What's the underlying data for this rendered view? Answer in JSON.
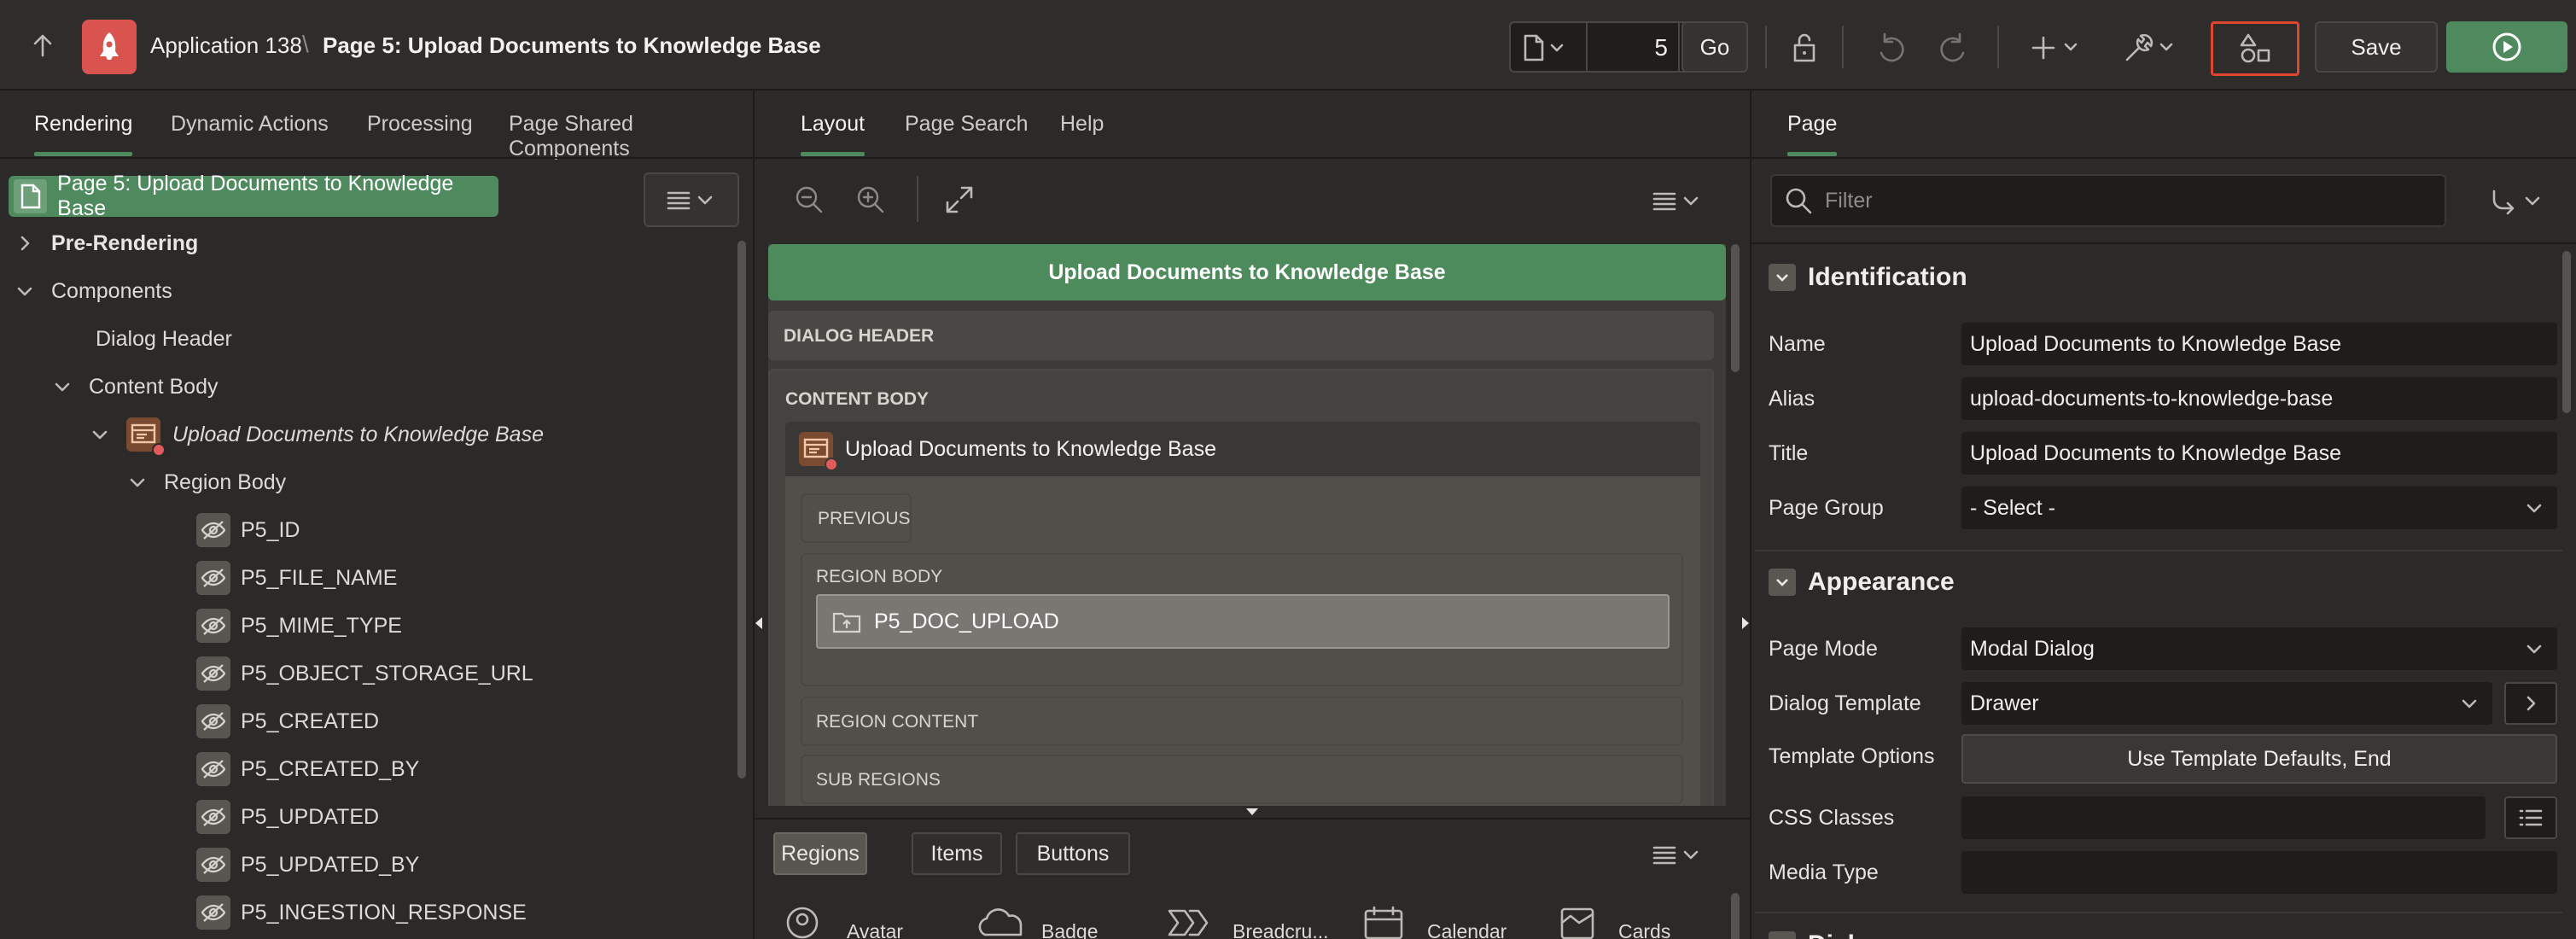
{
  "topbar": {
    "app_name": "Application 138",
    "separator": "\\",
    "page_title": "Page 5: Upload Documents to Knowledge Base",
    "page_number": "5",
    "go_label": "Go",
    "save_label": "Save"
  },
  "left": {
    "tabs": [
      "Rendering",
      "Dynamic Actions",
      "Processing",
      "Page Shared Components"
    ],
    "page_node": "Page 5: Upload Documents to Knowledge Base",
    "tree": {
      "pre_rendering": "Pre-Rendering",
      "components": "Components",
      "dialog_header": "Dialog Header",
      "content_body": "Content Body",
      "region": "Upload Documents to Knowledge Base",
      "region_body": "Region Body",
      "items": [
        "P5_ID",
        "P5_FILE_NAME",
        "P5_MIME_TYPE",
        "P5_OBJECT_STORAGE_URL",
        "P5_CREATED",
        "P5_CREATED_BY",
        "P5_UPDATED",
        "P5_UPDATED_BY",
        "P5_INGESTION_RESPONSE"
      ]
    }
  },
  "middle": {
    "tabs": [
      "Layout",
      "Page Search",
      "Help"
    ],
    "canvas": {
      "banner": "Upload Documents to Knowledge Base",
      "dialog_header": "DIALOG HEADER",
      "content_body": "CONTENT BODY",
      "region_title": "Upload Documents to Knowledge Base",
      "previous": "PREVIOUS",
      "region_body": "REGION BODY",
      "upload_item": "P5_DOC_UPLOAD",
      "region_content": "REGION CONTENT",
      "sub_regions": "SUB REGIONS"
    },
    "gallery": {
      "tabs": [
        "Regions",
        "Items",
        "Buttons"
      ],
      "components": [
        "Avatar",
        "Badge",
        "Breadcru...",
        "Calendar",
        "Cards"
      ]
    }
  },
  "right": {
    "tab": "Page",
    "filter_placeholder": "Filter",
    "identification": {
      "heading": "Identification",
      "name_label": "Name",
      "name_value": "Upload Documents to Knowledge Base",
      "alias_label": "Alias",
      "alias_value": "upload-documents-to-knowledge-base",
      "title_label": "Title",
      "title_value": "Upload Documents to Knowledge Base",
      "page_group_label": "Page Group",
      "page_group_value": "- Select -"
    },
    "appearance": {
      "heading": "Appearance",
      "page_mode_label": "Page Mode",
      "page_mode_value": "Modal Dialog",
      "dialog_template_label": "Dialog Template",
      "dialog_template_value": "Drawer",
      "template_options_label": "Template Options",
      "template_options_value": "Use Template Defaults, End",
      "css_classes_label": "CSS Classes",
      "media_type_label": "Media Type"
    },
    "next_heading": "Dialog"
  },
  "colors": {
    "accent_green": "#4f8a5f",
    "banner_green": "#4d8a5c",
    "app_icon_red": "#d9534f",
    "highlight_red": "#e0462f"
  }
}
